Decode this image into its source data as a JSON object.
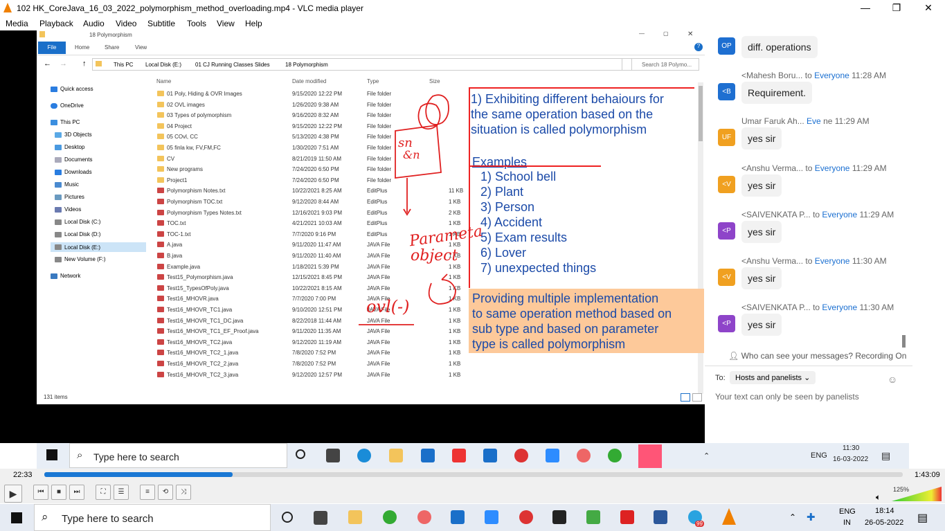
{
  "vlc": {
    "title": "102 HK_CoreJava_16_03_2022_polymorphism_method_overloading.mp4 - VLC media player",
    "menu": [
      "Media",
      "Playback",
      "Audio",
      "Video",
      "Subtitle",
      "Tools",
      "View",
      "Help"
    ],
    "elapsed": "22:33",
    "total": "1:43:09",
    "progress_fraction": 0.219,
    "volume": "125%"
  },
  "explorer": {
    "window_title": "18 Polymorphism",
    "ribbon_tabs": [
      "File",
      "Home",
      "Share",
      "View"
    ],
    "breadcrumb": [
      "This PC",
      "Local Disk (E:)",
      "01 CJ Running Classes Slides",
      "18 Polymorphism"
    ],
    "search_placeholder": "Search 18 Polymo...",
    "nav_items": [
      "Quick access",
      "OneDrive",
      "This PC",
      "3D Objects",
      "Desktop",
      "Documents",
      "Downloads",
      "Music",
      "Pictures",
      "Videos",
      "Local Disk (C:)",
      "Local Disk (D:)",
      "Local Disk (E:)",
      "New Volume (F:)",
      "Network"
    ],
    "columns": [
      "Name",
      "Date modified",
      "Type",
      "Size"
    ],
    "files": [
      {
        "name": "01 Poly, Hiding & OVR Images",
        "date": "9/15/2020 12:22 PM",
        "type": "File folder",
        "size": "",
        "kind": "folder"
      },
      {
        "name": "02 OVL images",
        "date": "1/26/2020 9:38 AM",
        "type": "File folder",
        "size": "",
        "kind": "folder"
      },
      {
        "name": "03 Types of polymorphism",
        "date": "9/16/2020 8:32 AM",
        "type": "File folder",
        "size": "",
        "kind": "folder"
      },
      {
        "name": "04 Project",
        "date": "9/15/2020 12:22 PM",
        "type": "File folder",
        "size": "",
        "kind": "folder"
      },
      {
        "name": "05 COvl, CC",
        "date": "5/13/2020 4:38 PM",
        "type": "File folder",
        "size": "",
        "kind": "folder"
      },
      {
        "name": "05 finla kw, FV,FM,FC",
        "date": "1/30/2020 7:51 AM",
        "type": "File folder",
        "size": "",
        "kind": "folder"
      },
      {
        "name": "CV",
        "date": "8/21/2019 11:50 AM",
        "type": "File folder",
        "size": "",
        "kind": "folder"
      },
      {
        "name": "New programs",
        "date": "7/24/2020 6:50 PM",
        "type": "File folder",
        "size": "",
        "kind": "folder"
      },
      {
        "name": "Project1",
        "date": "7/24/2020 6:50 PM",
        "type": "File folder",
        "size": "",
        "kind": "folder"
      },
      {
        "name": "Polymorphism Notes.txt",
        "date": "10/22/2021 8:25 AM",
        "type": "EditPlus",
        "size": "11 KB",
        "kind": "file"
      },
      {
        "name": "Polymorphism TOC.txt",
        "date": "9/12/2020 8:44 AM",
        "type": "EditPlus",
        "size": "1 KB",
        "kind": "file"
      },
      {
        "name": "Polymorphism Types Notes.txt",
        "date": "12/16/2021 9:03 PM",
        "type": "EditPlus",
        "size": "2 KB",
        "kind": "file"
      },
      {
        "name": "TOC.txt",
        "date": "4/21/2021 10:03 AM",
        "type": "EditPlus",
        "size": "1 KB",
        "kind": "file"
      },
      {
        "name": "TOC-1.txt",
        "date": "7/7/2020 9:16 PM",
        "type": "EditPlus",
        "size": "1 KB",
        "kind": "file"
      },
      {
        "name": "A.java",
        "date": "9/11/2020 11:47 AM",
        "type": "JAVA File",
        "size": "1 KB",
        "kind": "file"
      },
      {
        "name": "B.java",
        "date": "9/11/2020 11:40 AM",
        "type": "JAVA File",
        "size": "1 KB",
        "kind": "file"
      },
      {
        "name": "Example.java",
        "date": "1/18/2021 5:39 PM",
        "type": "JAVA File",
        "size": "1 KB",
        "kind": "file"
      },
      {
        "name": "Test15_Polymorphism.java",
        "date": "12/15/2021 8:45 PM",
        "type": "JAVA File",
        "size": "1 KB",
        "kind": "file"
      },
      {
        "name": "Test15_TypesOfPoly.java",
        "date": "10/22/2021 8:15 AM",
        "type": "JAVA File",
        "size": "1 KB",
        "kind": "file"
      },
      {
        "name": "Test16_MHOVR.java",
        "date": "7/7/2020 7:00 PM",
        "type": "JAVA File",
        "size": "1 KB",
        "kind": "file"
      },
      {
        "name": "Test16_MHOVR_TC1.java",
        "date": "9/10/2020 12:51 PM",
        "type": "JAVA File",
        "size": "1 KB",
        "kind": "file"
      },
      {
        "name": "Test16_MHOVR_TC1_DC.java",
        "date": "8/22/2018 11:44 AM",
        "type": "JAVA File",
        "size": "1 KB",
        "kind": "file"
      },
      {
        "name": "Test16_MHOVR_TC1_EF_Proof.java",
        "date": "9/11/2020 11:35 AM",
        "type": "JAVA File",
        "size": "1 KB",
        "kind": "file"
      },
      {
        "name": "Test16_MHOVR_TC2.java",
        "date": "9/12/2020 11:19 AM",
        "type": "JAVA File",
        "size": "1 KB",
        "kind": "file"
      },
      {
        "name": "Test16_MHOVR_TC2_1.java",
        "date": "7/8/2020 7:52 PM",
        "type": "JAVA File",
        "size": "1 KB",
        "kind": "file"
      },
      {
        "name": "Test16_MHOVR_TC2_2.java",
        "date": "7/8/2020 7:52 PM",
        "type": "JAVA File",
        "size": "1 KB",
        "kind": "file"
      },
      {
        "name": "Test16_MHOVR_TC2_3.java",
        "date": "9/12/2020 12:57 PM",
        "type": "JAVA File",
        "size": "1 KB",
        "kind": "file"
      }
    ],
    "status": "131 items"
  },
  "slide": {
    "definition": [
      "1) Exhibiting different behaiours for",
      "the same operation based on the",
      "situation is called polymorphism"
    ],
    "examples_title": "Examples",
    "examples": [
      "1) School bell",
      "2) Plant",
      "3) Person",
      "4) Accident",
      "5) Exam results",
      "6) Lover",
      "7) unexpected things"
    ],
    "box": [
      "Providing multiple implementation",
      "to same operation method based on",
      "sub type and based on parameter",
      "type is called polymorphism"
    ],
    "ink": {
      "sn": "sn",
      "sn2": "&n",
      "param": "Parameta",
      "object": "object",
      "ovl": "ovl(-)"
    }
  },
  "chat": {
    "messages": [
      {
        "initials": "OP",
        "color": "#1e6fd1",
        "sender": "",
        "to": "",
        "time": "",
        "text": "diff. operations"
      },
      {
        "initials": "<B",
        "color": "#1e6fd1",
        "sender": "<Mahesh Boru...",
        "to": "to",
        "everyone": "Everyone",
        "time": "11:28 AM",
        "text": "Requirement."
      },
      {
        "initials": "UF",
        "color": "#f0a020",
        "sender": "Umar Faruk Ah...",
        "to": "",
        "everyone": "Eve",
        "time": "ne 11:29 AM",
        "text": "yes sir"
      },
      {
        "initials": "<V",
        "color": "#f0a020",
        "sender": "<Anshu Verma...",
        "to": "to",
        "everyone": "Everyone",
        "time": "11:29 AM",
        "text": "yes sir"
      },
      {
        "initials": "<P",
        "color": "#8e44c9",
        "sender": "<SAIVENKATA P...",
        "to": "to",
        "everyone": "Everyone",
        "time": "11:29 AM",
        "text": "yes sir"
      },
      {
        "initials": "<V",
        "color": "#f0a020",
        "sender": "<Anshu Verma...",
        "to": "to",
        "everyone": "Everyone",
        "time": "11:30 AM",
        "text": "yes sir"
      },
      {
        "initials": "<P",
        "color": "#8e44c9",
        "sender": "<SAIVENKATA P...",
        "to": "to",
        "everyone": "Everyone",
        "time": "11:30 AM",
        "text": "yes sir"
      }
    ],
    "who_can_see": "Who can see your messages? Recording On",
    "to_label": "To:",
    "to_value": "Hosts and panelists",
    "placeholder": "Your text can only be seen by panelists"
  },
  "inner_taskbar": {
    "search": "Type here to search",
    "lang": "ENG",
    "time": "11:30",
    "date": "16-03-2022"
  },
  "outer_taskbar": {
    "search": "Type here to search",
    "lang": "ENG",
    "lang2": "IN",
    "time": "18:14",
    "date": "26-05-2022",
    "badge": "99"
  }
}
